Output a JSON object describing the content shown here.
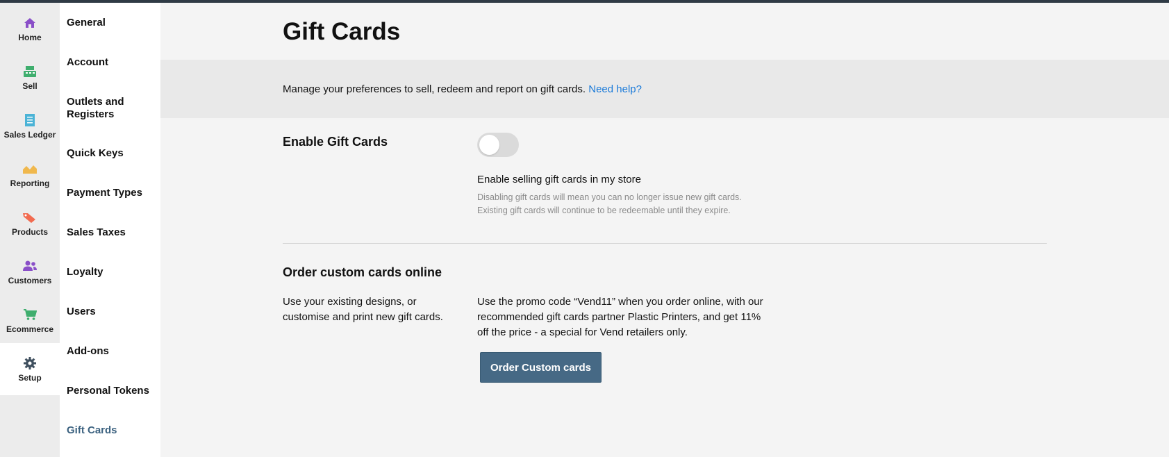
{
  "rail": {
    "items": [
      {
        "label": "Home",
        "icon": "home-icon",
        "color": "#8a4fc8"
      },
      {
        "label": "Sell",
        "icon": "register-icon",
        "color": "#3fae6e"
      },
      {
        "label": "Sales Ledger",
        "icon": "ledger-icon",
        "color": "#4bb3d6"
      },
      {
        "label": "Reporting",
        "icon": "chart-icon",
        "color": "#f0b84d"
      },
      {
        "label": "Products",
        "icon": "tag-icon",
        "color": "#f26b50"
      },
      {
        "label": "Customers",
        "icon": "people-icon",
        "color": "#8a4fc8"
      },
      {
        "label": "Ecommerce",
        "icon": "cart-icon",
        "color": "#3fae6e"
      },
      {
        "label": "Setup",
        "icon": "gear-icon",
        "color": "#3f4f5e"
      }
    ]
  },
  "subnav": {
    "items": [
      {
        "label": "General"
      },
      {
        "label": "Account"
      },
      {
        "label": "Outlets and Registers"
      },
      {
        "label": "Quick Keys"
      },
      {
        "label": "Payment Types"
      },
      {
        "label": "Sales Taxes"
      },
      {
        "label": "Loyalty"
      },
      {
        "label": "Users"
      },
      {
        "label": "Add-ons"
      },
      {
        "label": "Personal Tokens"
      },
      {
        "label": "Gift Cards"
      }
    ]
  },
  "page": {
    "title": "Gift Cards",
    "banner_text": "Manage your preferences to sell, redeem and report on gift cards.",
    "banner_link": "Need help?"
  },
  "enable": {
    "title": "Enable Gift Cards",
    "toggle_on": false,
    "toggle_label": "Enable selling gift cards in my store",
    "help_line1": "Disabling gift cards will mean you can no longer issue new gift cards.",
    "help_line2": "Existing gift cards will continue to be redeemable until they expire."
  },
  "order": {
    "title": "Order custom cards online",
    "left_line1": "Use your existing designs, or",
    "left_line2": "customise and print new gift cards.",
    "right_line1": "Use the promo code “Vend11” when you order online, with our",
    "right_line2": "recommended gift cards partner Plastic Printers, and get 11%",
    "right_line3": "off the price - a special for Vend retailers only.",
    "button_label": "Order Custom cards"
  },
  "colors": {
    "accent": "#466985",
    "link": "#1a7ad9"
  }
}
